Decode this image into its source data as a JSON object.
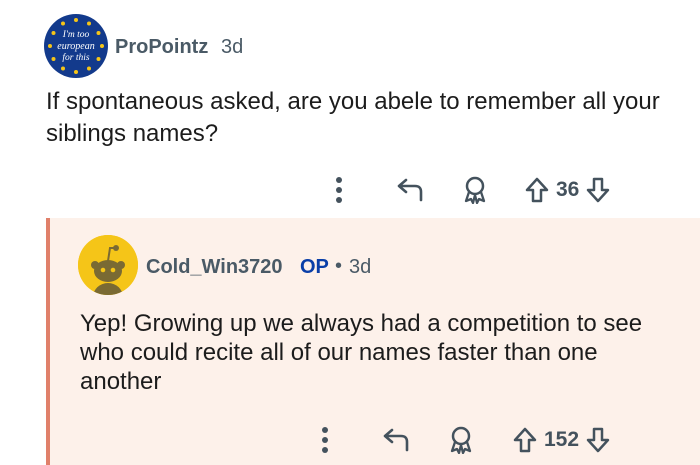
{
  "comment": {
    "author": "ProPointz",
    "age": "3d",
    "avatar": {
      "icon": "eu-flag-badge-icon",
      "badge_text": [
        "I'm too",
        "european",
        "for this"
      ]
    },
    "text": "If spontaneous asked, are you abele to remember all your siblings names?",
    "votes": "36"
  },
  "reply": {
    "author": "Cold_Win3720",
    "op_label": "OP",
    "separator": "•",
    "age": "3d",
    "avatar": {
      "icon": "snoo-avatar-icon"
    },
    "text": "Yep! Growing up we always had a competition to see who could recite all of our names faster than one another",
    "votes": "152"
  },
  "colors": {
    "reply_bg": "#fdf1ea",
    "reply_bar": "#e0806a",
    "op_blue": "#0a3fa8",
    "meta_gray": "#4a5a66"
  }
}
